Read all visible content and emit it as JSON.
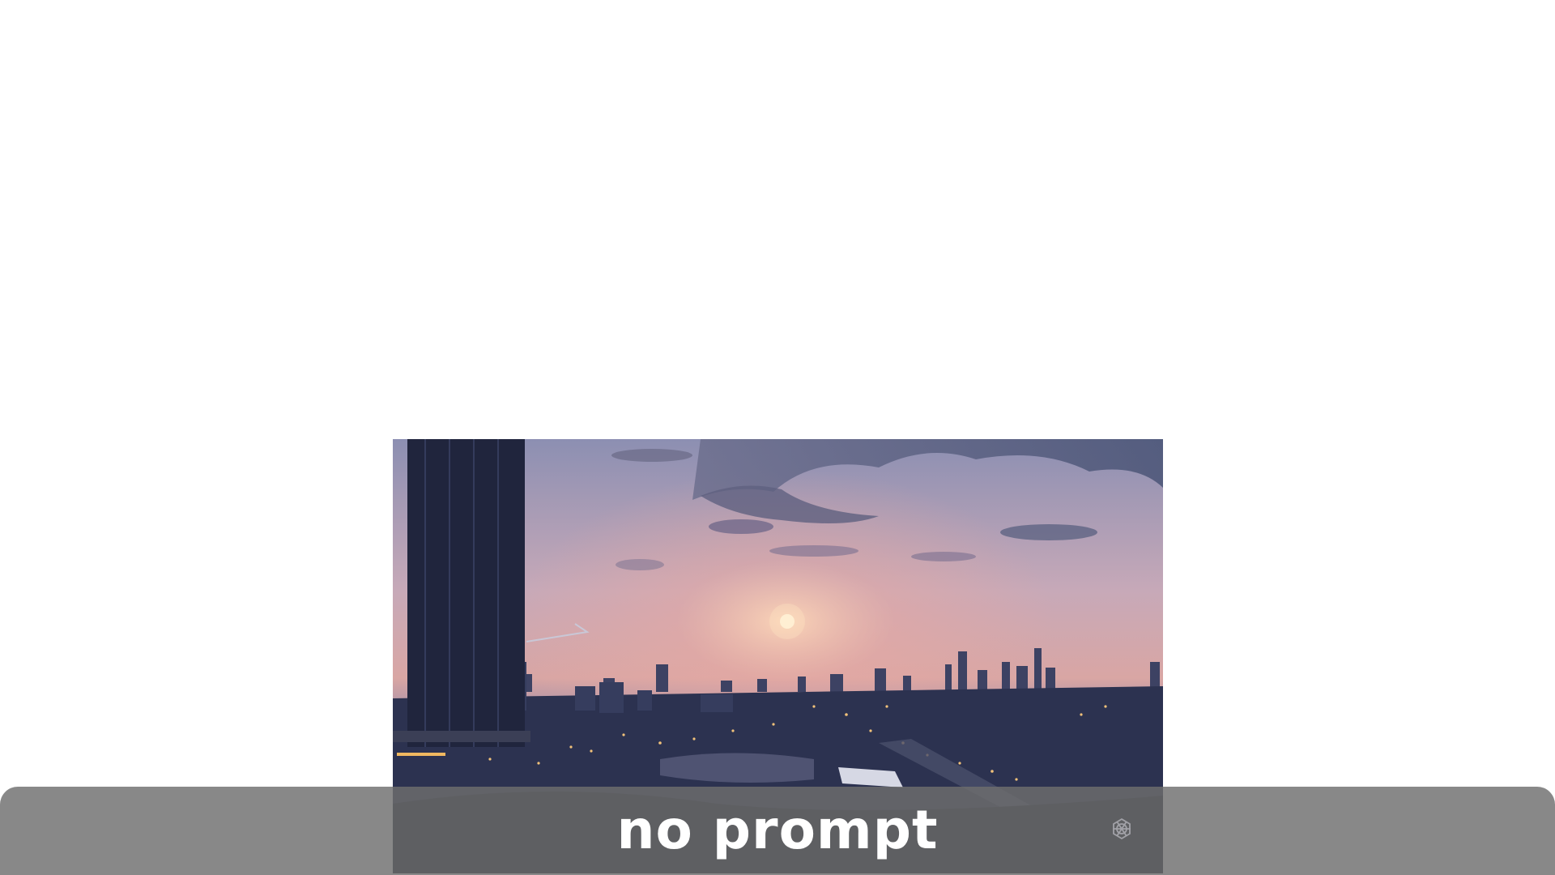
{
  "video": {
    "scene": "city-skyline-sunset",
    "colors": {
      "sky_top": "#7a7fa6",
      "sky_glow": "#e9b8b0",
      "sun": "#fff3d6",
      "city": "#1c2135"
    }
  },
  "caption": {
    "text": "no prompt"
  },
  "watermark": {
    "icon": "openai-logo-icon"
  }
}
